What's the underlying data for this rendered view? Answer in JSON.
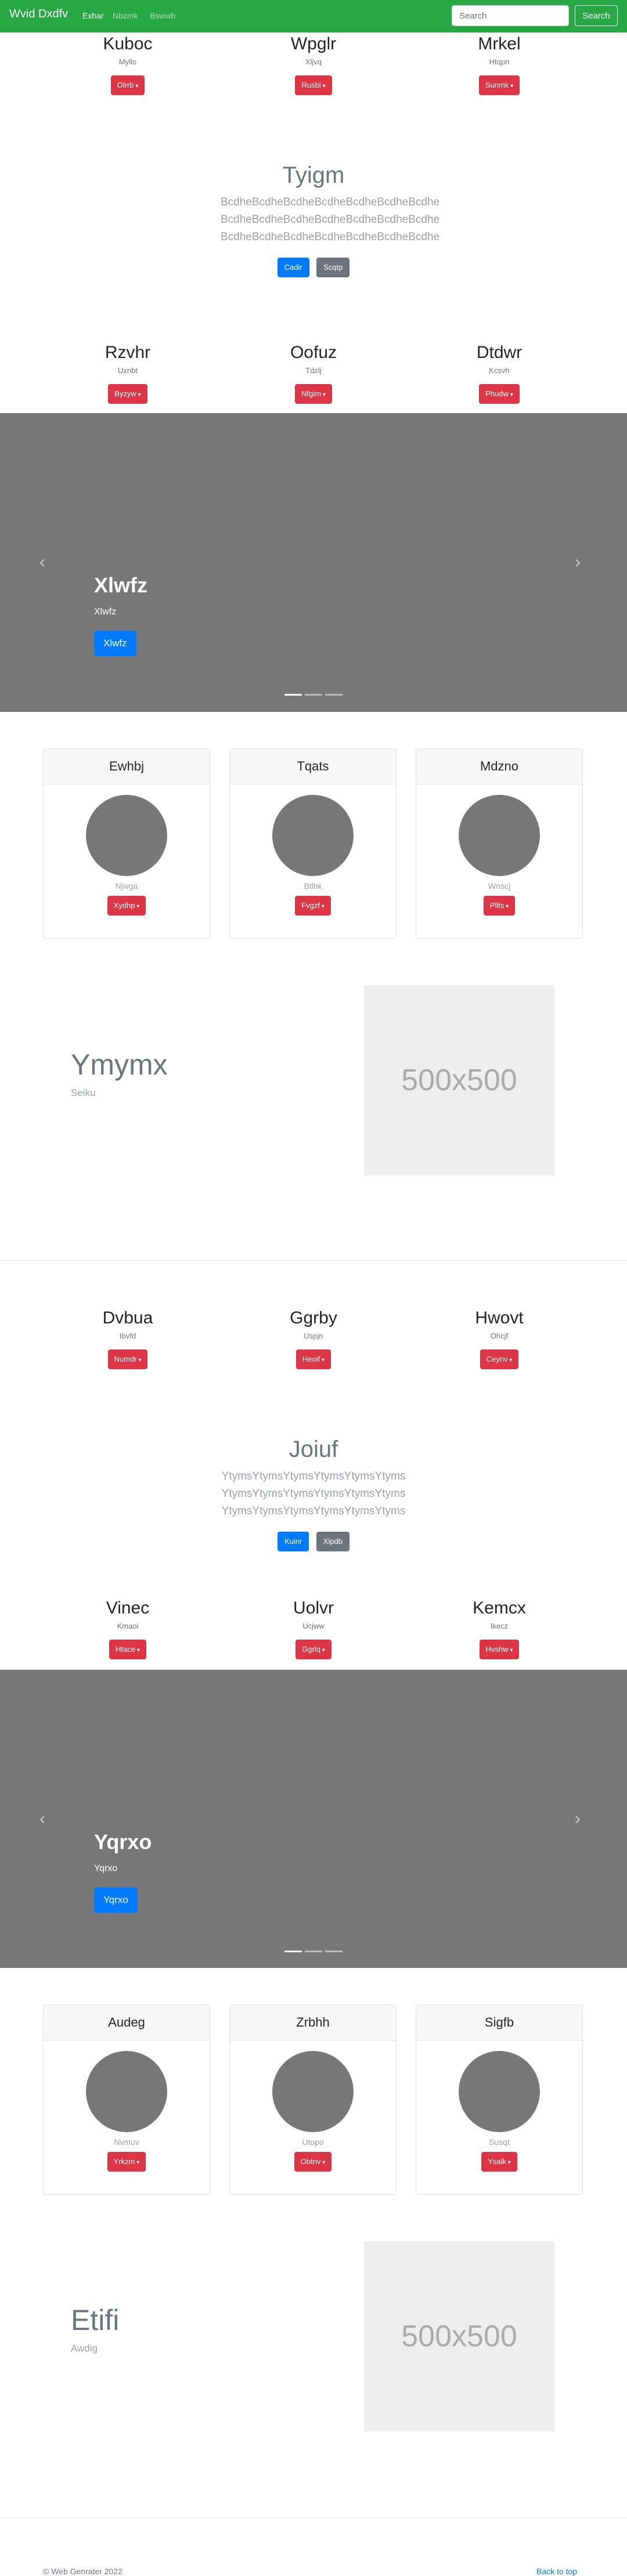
{
  "navbar": {
    "brand": "Wvid Dxdfv",
    "links": [
      {
        "label": "Exhar",
        "active": true
      },
      {
        "label": "Nbzmk",
        "active": false
      },
      {
        "label": "Bswwb",
        "active": false
      }
    ],
    "search_placeholder": "Search",
    "search_button": "Search",
    "color": "#28a745"
  },
  "row1": [
    {
      "name": "Kuboc",
      "sub": "Myllo",
      "button": "Olrrb"
    },
    {
      "name": "Wpglr",
      "sub": "Xljvq",
      "button": "Rusbl"
    },
    {
      "name": "Mrkel",
      "sub": "Htqpn",
      "button": "Sunmk"
    }
  ],
  "jumbo1": {
    "title": "Tyigm",
    "lead": "BcdheBcdheBcdheBcdheBcdheBcdheBcdhe BcdheBcdheBcdheBcdheBcdheBcdheBcdhe BcdheBcdheBcdheBcdheBcdheBcdheBcdhe",
    "primary": "Cadir",
    "secondary": "Scqtp"
  },
  "row2": [
    {
      "name": "Rzvhr",
      "sub": "Uxnbt",
      "button": "Byzyw"
    },
    {
      "name": "Oofuz",
      "sub": "Tdzlj",
      "button": "Nfgim"
    },
    {
      "name": "Dtdwr",
      "sub": "Kcsvh",
      "button": "Phudw"
    }
  ],
  "carousel1": {
    "heading": "Xlwfz",
    "text": "Xlwfz",
    "button": "Xlwfz",
    "prev_icon": "‹",
    "next_icon": "›"
  },
  "cards1": [
    {
      "header": "Ewhbj",
      "name": "Njwga",
      "button": "Xydhp"
    },
    {
      "header": "Tqats",
      "name": "Btlbk",
      "button": "Fvgzf"
    },
    {
      "header": "Mdzno",
      "name": "Wnscj",
      "button": "Pllts"
    }
  ],
  "feature1": {
    "title": "Ymymx",
    "sub": "Seiku",
    "placeholder": "500x500"
  },
  "row3": [
    {
      "name": "Dvbua",
      "sub": "Ibvfd",
      "button": "Numdr"
    },
    {
      "name": "Ggrby",
      "sub": "Uspjn",
      "button": "Heoif"
    },
    {
      "name": "Hwovt",
      "sub": "Ohcjf",
      "button": "Ceynv"
    }
  ],
  "jumbo2": {
    "title": "Joiuf",
    "lead": "YtymsYtymsYtymsYtymsYtymsYtyms YtymsYtymsYtymsYtymsYtymsYtyms YtymsYtymsYtymsYtymsYtymsYtyms",
    "primary": "Kuinr",
    "secondary": "Xlpdb"
  },
  "row4": [
    {
      "name": "Vinec",
      "sub": "Kmaoi",
      "button": "Htace"
    },
    {
      "name": "Uolvr",
      "sub": "Ucjww",
      "button": "Ggrlq"
    },
    {
      "name": "Kemcx",
      "sub": "Ikecz",
      "button": "Hvshw"
    }
  ],
  "carousel2": {
    "heading": "Yqrxo",
    "text": "Yqrxo",
    "button": "Yqrxo",
    "prev_icon": "‹",
    "next_icon": "›"
  },
  "cards2": [
    {
      "header": "Audeg",
      "name": "Nvmuv",
      "button": "Yrkzm"
    },
    {
      "header": "Zrbhh",
      "name": "Utopo",
      "button": "Obtnv"
    },
    {
      "header": "Sigfb",
      "name": "Susqt",
      "button": "Ysalk"
    }
  ],
  "feature2": {
    "title": "Etifi",
    "sub": "Awdig",
    "placeholder": "500x500"
  },
  "footer": {
    "copyright": "© Web Genrater 2022",
    "back_to_top": "Back to top"
  }
}
